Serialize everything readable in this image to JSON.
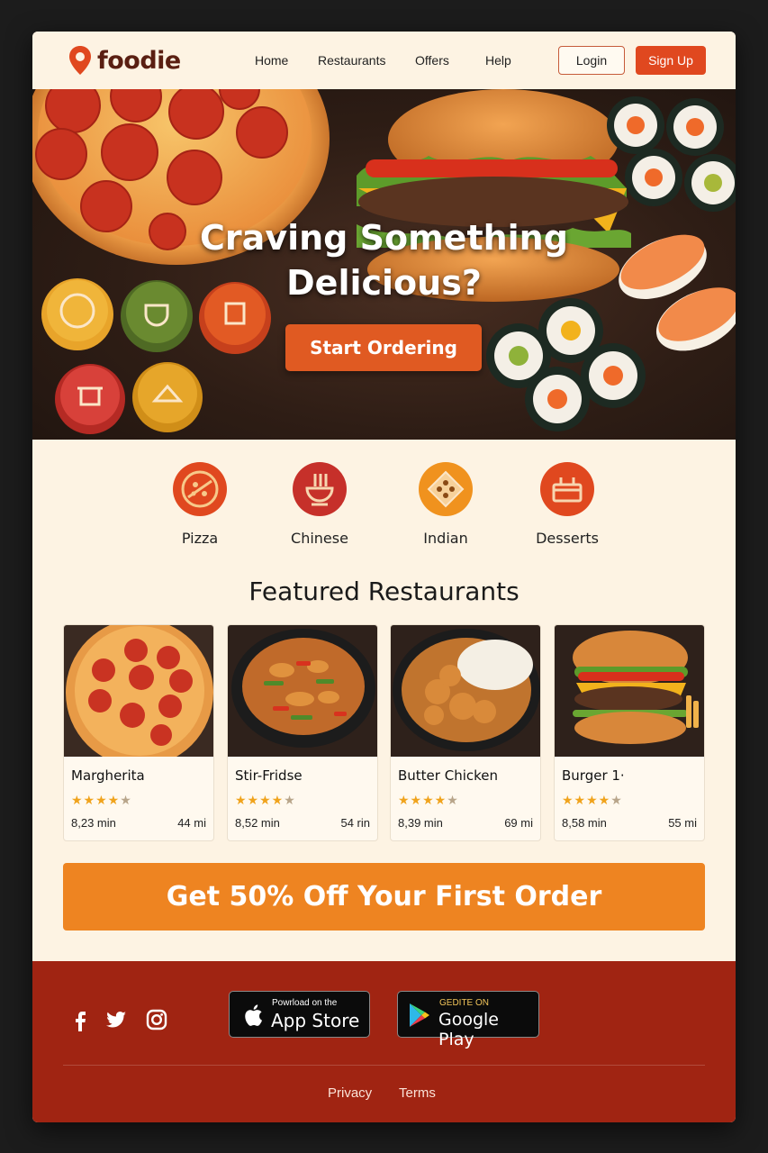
{
  "brand": {
    "name": "foodie",
    "accent": "#e0481f",
    "logo_icon": "location-pin-icon"
  },
  "nav": {
    "links": [
      "Home",
      "Restaurants",
      "Offers",
      "Help"
    ],
    "login_label": "Login",
    "signup_label": "Sign Up"
  },
  "hero": {
    "title_line1": "Craving Something",
    "title_line2": "Delicious?",
    "cta_label": "Start Ordering"
  },
  "categories": [
    {
      "label": "Pizza",
      "icon": "pizza-icon",
      "color": "#e0481f"
    },
    {
      "label": "Chinese",
      "icon": "noodle-bowl-icon",
      "color": "#c6302a"
    },
    {
      "label": "Indian",
      "icon": "indian-dish-icon",
      "color": "#f0921e"
    },
    {
      "label": "Desserts",
      "icon": "dessert-box-icon",
      "color": "#e0481f"
    }
  ],
  "featured_title": "Featured Restaurants",
  "restaurants": [
    {
      "name": "Margherita",
      "rating": 4.5,
      "time": "8,23 min",
      "distance": "44 mi"
    },
    {
      "name": "Stir-Fridse",
      "rating": 4.5,
      "time": "8,52 min",
      "distance": "54 rin"
    },
    {
      "name": "Butter Chicken",
      "rating": 4.5,
      "time": "8,39 min",
      "distance": "69 mi"
    },
    {
      "name": "Burger 1·",
      "rating": 4.5,
      "time": "8,58 min",
      "distance": "55 mi"
    }
  ],
  "promo_label": "Get 50% Off Your First Order",
  "footer": {
    "social_icons": [
      "facebook-icon",
      "twitter-icon",
      "instagram-icon"
    ],
    "app_store": {
      "small": "Powrload on the",
      "big": "App Store"
    },
    "google_play": {
      "small": "GEDITE ON",
      "big": "Google Play"
    },
    "links": [
      "Privacy",
      "Terms"
    ]
  }
}
